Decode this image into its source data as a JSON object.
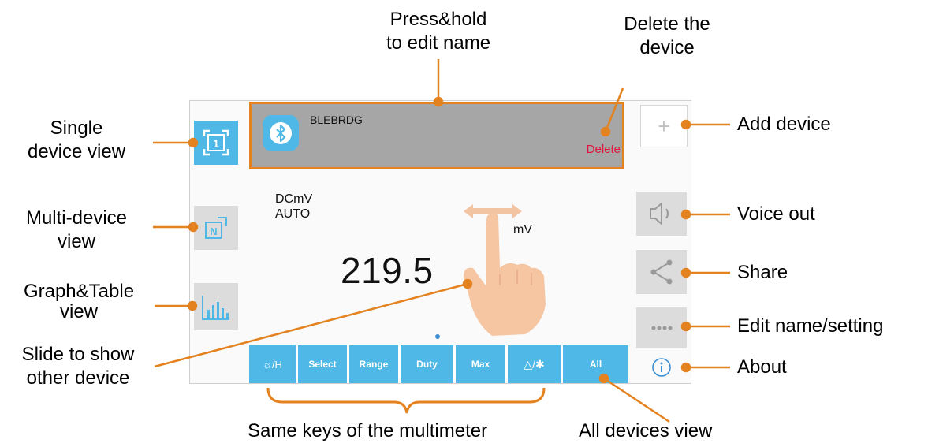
{
  "annotations": {
    "press_hold": [
      "Press&hold",
      "to edit name"
    ],
    "delete_device": [
      "Delete the",
      "device"
    ],
    "single_view": [
      "Single",
      "device view"
    ],
    "multi_view": [
      "Multi-device",
      "view"
    ],
    "graph_view": [
      "Graph&Table",
      "view"
    ],
    "slide": [
      "Slide to show",
      "other device"
    ],
    "add_device": "Add device",
    "voice_out": "Voice out",
    "share": "Share",
    "edit_name": "Edit name/setting",
    "about": "About",
    "same_keys": "Same keys of the multimeter",
    "all_devices": "All devices view"
  },
  "app": {
    "device_name": "BLEBRDG",
    "delete_label": "Delete",
    "mode": "DCmV",
    "range": "AUTO",
    "unit": "mV",
    "reading": "219.5",
    "single_view_label": "1",
    "multi_view_label": "N",
    "add_label": "+",
    "keys": [
      "☼/H",
      "Select",
      "Range",
      "Duty",
      "Max",
      "△/✱",
      "All"
    ]
  },
  "colors": {
    "accent_blue": "#4fb8e6",
    "callout_orange": "#e4821f",
    "delete_red": "#e0143c",
    "header_gray": "#a6a6a6"
  }
}
